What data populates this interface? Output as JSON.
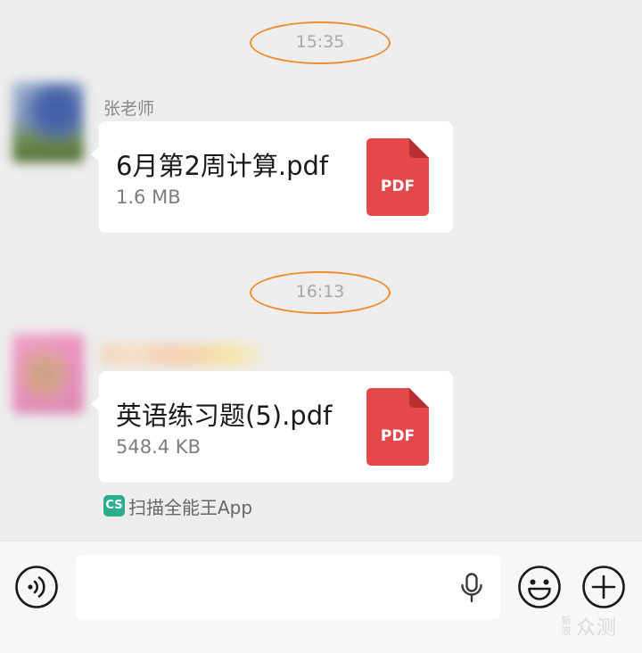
{
  "timestamps": [
    "15:35",
    "16:13"
  ],
  "messages": [
    {
      "sender": "张老师",
      "file_name": "6月第2周计算.pdf",
      "file_size": "1.6 MB",
      "file_icon_label": "PDF"
    },
    {
      "sender": "",
      "file_name": "英语练习题(5).pdf",
      "file_size": "548.4 KB",
      "file_icon_label": "PDF",
      "source_logo": "CS",
      "source": "扫描全能王App"
    }
  ],
  "input_bar": {
    "placeholder": "",
    "icons": [
      "voice-icon",
      "microphone-icon",
      "emoji-icon",
      "plus-icon"
    ]
  },
  "watermark": {
    "small": "新浪",
    "big": "众测"
  },
  "colors": {
    "background": "#ededed",
    "bubble": "#ffffff",
    "pdf_red": "#e5484a",
    "pdf_fold": "#b82f31",
    "highlight_ring": "#f08c2b",
    "cs_logo": "#2bae8e"
  }
}
